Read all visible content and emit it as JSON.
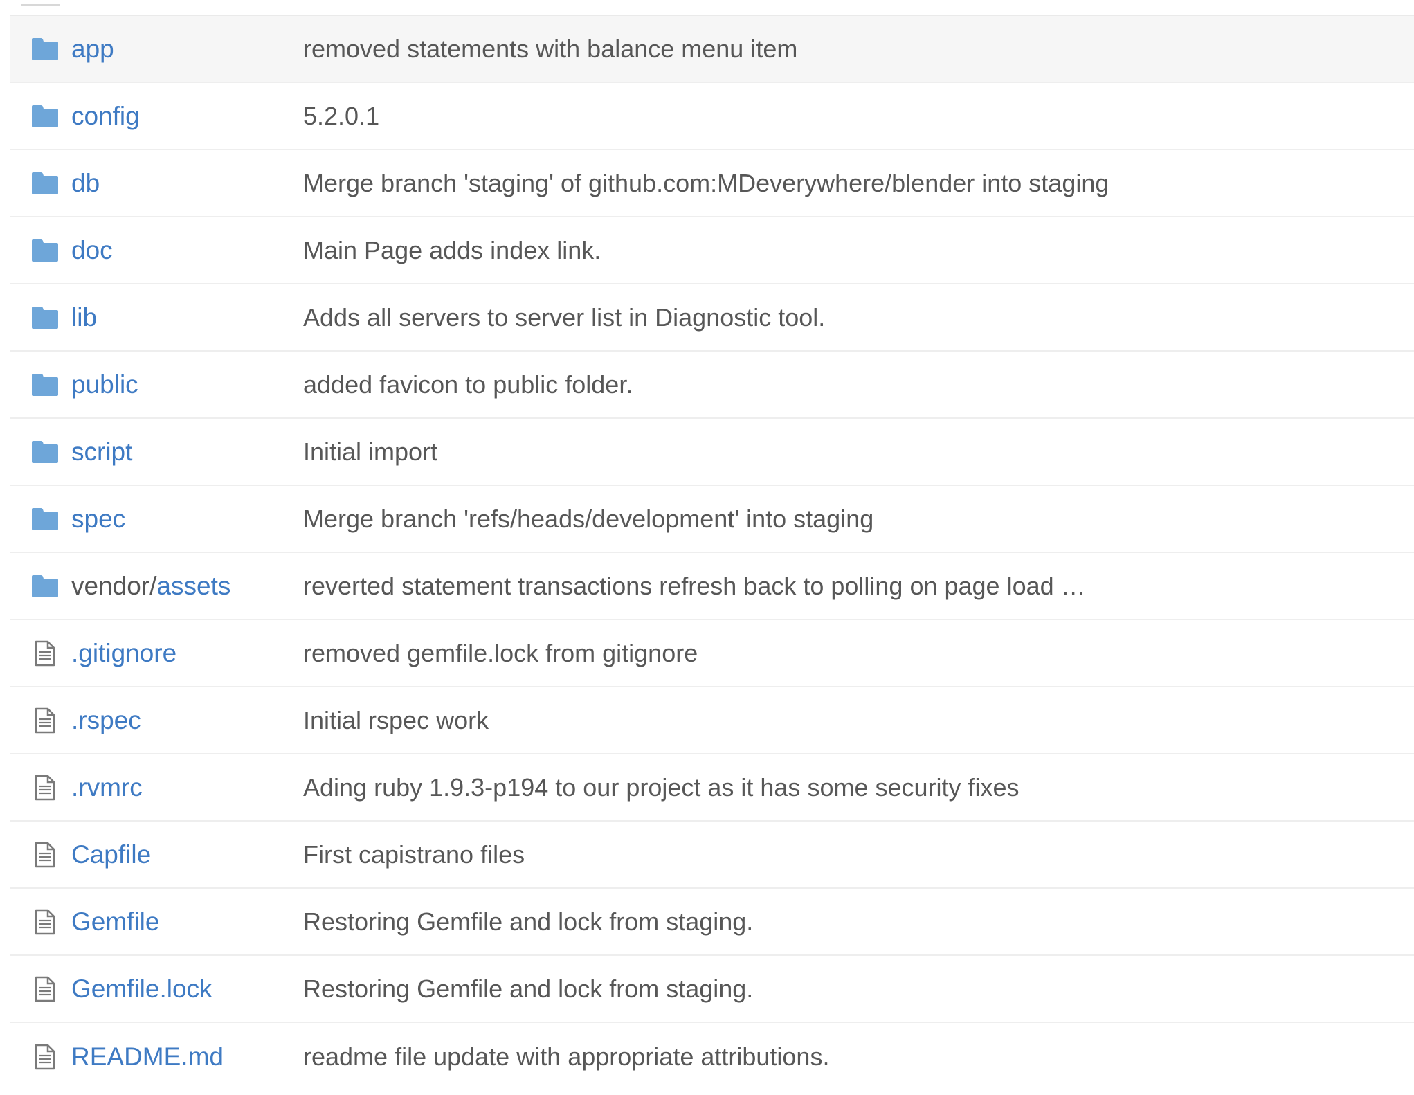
{
  "colors": {
    "link": "#3e7ac3",
    "message_text": "#575757",
    "folder_icon": "#6ea6d9",
    "file_icon_stroke": "#7a7a7a",
    "row_border": "#eeeeee",
    "first_row_bg": "#f6f6f6"
  },
  "files": [
    {
      "type": "folder",
      "icon": "folder-icon",
      "name": "app",
      "message": "removed statements with balance menu item"
    },
    {
      "type": "folder",
      "icon": "folder-icon",
      "name": "config",
      "message": "5.2.0.1"
    },
    {
      "type": "folder",
      "icon": "folder-icon",
      "name": "db",
      "message": "Merge branch 'staging' of github.com:MDeverywhere/blender into staging"
    },
    {
      "type": "folder",
      "icon": "folder-icon",
      "name": "doc",
      "message": "Main Page adds index link."
    },
    {
      "type": "folder",
      "icon": "folder-icon",
      "name": "lib",
      "message": "Adds all servers to server list in Diagnostic tool."
    },
    {
      "type": "folder",
      "icon": "folder-icon",
      "name": "public",
      "message": "added favicon to public folder."
    },
    {
      "type": "folder",
      "icon": "folder-icon",
      "name": "script",
      "message": "Initial import"
    },
    {
      "type": "folder",
      "icon": "folder-icon",
      "name": "spec",
      "message": "Merge branch 'refs/heads/development' into staging"
    },
    {
      "type": "folder",
      "icon": "folder-icon",
      "name_prefix": "vendor/",
      "name": "assets",
      "message": "reverted statement transactions refresh back to polling on page load …"
    },
    {
      "type": "file",
      "icon": "file-icon",
      "name": ".gitignore",
      "message": "removed gemfile.lock from gitignore"
    },
    {
      "type": "file",
      "icon": "file-icon",
      "name": ".rspec",
      "message": "Initial rspec work"
    },
    {
      "type": "file",
      "icon": "file-icon",
      "name": ".rvmrc",
      "message": "Ading ruby 1.9.3-p194 to our project as it has some security fixes"
    },
    {
      "type": "file",
      "icon": "file-icon",
      "name": "Capfile",
      "message": "First capistrano files"
    },
    {
      "type": "file",
      "icon": "file-icon",
      "name": "Gemfile",
      "message": "Restoring Gemfile and lock from staging."
    },
    {
      "type": "file",
      "icon": "file-icon",
      "name": "Gemfile.lock",
      "message": "Restoring Gemfile and lock from staging."
    },
    {
      "type": "file",
      "icon": "file-icon",
      "name": "README.md",
      "message": "readme file update with appropriate attributions."
    }
  ]
}
